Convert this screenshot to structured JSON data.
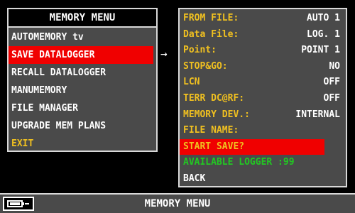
{
  "menu": {
    "title": "MEMORY MENU",
    "items": [
      {
        "label": "AUTOMEMORY tv"
      },
      {
        "label": "SAVE DATALOGGER"
      },
      {
        "label": "RECALL DATALOGGER"
      },
      {
        "label": "MANUMEMORY"
      },
      {
        "label": "FILE MANAGER"
      },
      {
        "label": "UPGRADE MEM PLANS"
      },
      {
        "label": "EXIT"
      }
    ],
    "selected_index": 1
  },
  "arrow": "→",
  "details": {
    "rows": [
      {
        "label": "FROM FILE:",
        "value": "AUTO 1"
      },
      {
        "label": "Data File:",
        "value": "LOG. 1"
      },
      {
        "label": "Point:",
        "value": "POINT 1"
      },
      {
        "label": "STOP&GO:",
        "value": "NO"
      },
      {
        "label": "LCN",
        "value": "OFF"
      },
      {
        "label": "TERR DC@RF:",
        "value": "OFF"
      },
      {
        "label": "MEMORY DEV.:",
        "value": "INTERNAL"
      },
      {
        "label": "FILE NAME:",
        "value": ""
      }
    ],
    "start_save": "START SAVE?",
    "available_logger": "AVAILABLE LOGGER :99",
    "back": "BACK"
  },
  "status_bar": {
    "title": "MEMORY MENU",
    "battery_icon": "battery-plug-icon"
  },
  "colors": {
    "highlight": "#f00000",
    "label_yellow": "#f0c020",
    "available_green": "#22c822",
    "panel_bg": "#4a4a4a"
  }
}
